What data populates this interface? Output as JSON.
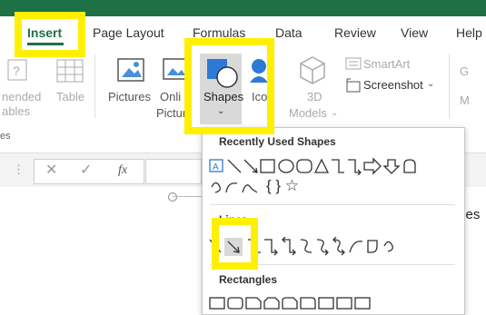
{
  "tabs": [
    "Insert",
    "Page Layout",
    "Formulas",
    "Data",
    "Review",
    "View",
    "Help"
  ],
  "ribbon": {
    "truncated_left": [
      "nended",
      "ables",
      "es"
    ],
    "table": "Table",
    "pictures": "Pictures",
    "online_pictures_l1": "Onli",
    "online_pictures_l2": "Pictur",
    "shapes": "Shapes",
    "icons": "Ico",
    "models_l1": "3D",
    "models_l2": "Models",
    "smartart": "SmartArt",
    "screenshot": "Screenshot",
    "right_partial_1": "G",
    "right_partial_2": "M"
  },
  "formula": {
    "fx": "fx"
  },
  "sheet_text": "ces",
  "shapes_menu": {
    "recent_title": "Recently Used Shapes",
    "lines_title": "Lines",
    "rectangles_title": "Rectangles",
    "recent_text_symbols": "{ } ☆"
  },
  "colors": {
    "brand_green": "#1e7145",
    "highlight": "#ffef00",
    "icon_blue": "#2b7bd6"
  }
}
